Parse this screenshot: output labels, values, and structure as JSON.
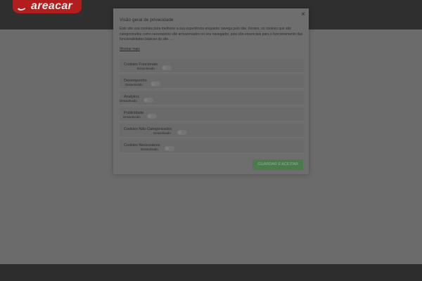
{
  "header": {
    "logo_text": "areacar"
  },
  "modal": {
    "close_glyph": "×",
    "title": "Visão geral de privacidade",
    "description": "Este site usa cookies para melhorar a sua experiência enquanto navega pelo site. Destes, os cookies que são categorizados como necessários são armazenados no seu navegador, pois são essenciais para o funcionamento das funcionalidades básicas do site. ...",
    "show_more": "Mostrar mais",
    "categories": [
      {
        "label": "Cookies Funcionais",
        "status": "Desactivado"
      },
      {
        "label": "Desempenho",
        "status": "Desactivado"
      },
      {
        "label": "Analytics",
        "status": "Desactivado"
      },
      {
        "label": "Publicidade",
        "status": "Desactivado"
      },
      {
        "label": "Cookies Não Categorizados",
        "status": "Desactivado"
      },
      {
        "label": "Cookies Necessários",
        "status": "Desactivado"
      }
    ],
    "save_label": "GUARDAR E ACEITAR"
  },
  "colors": {
    "brand_red": "#b21e1e",
    "accept_green": "#4b7a4c"
  }
}
